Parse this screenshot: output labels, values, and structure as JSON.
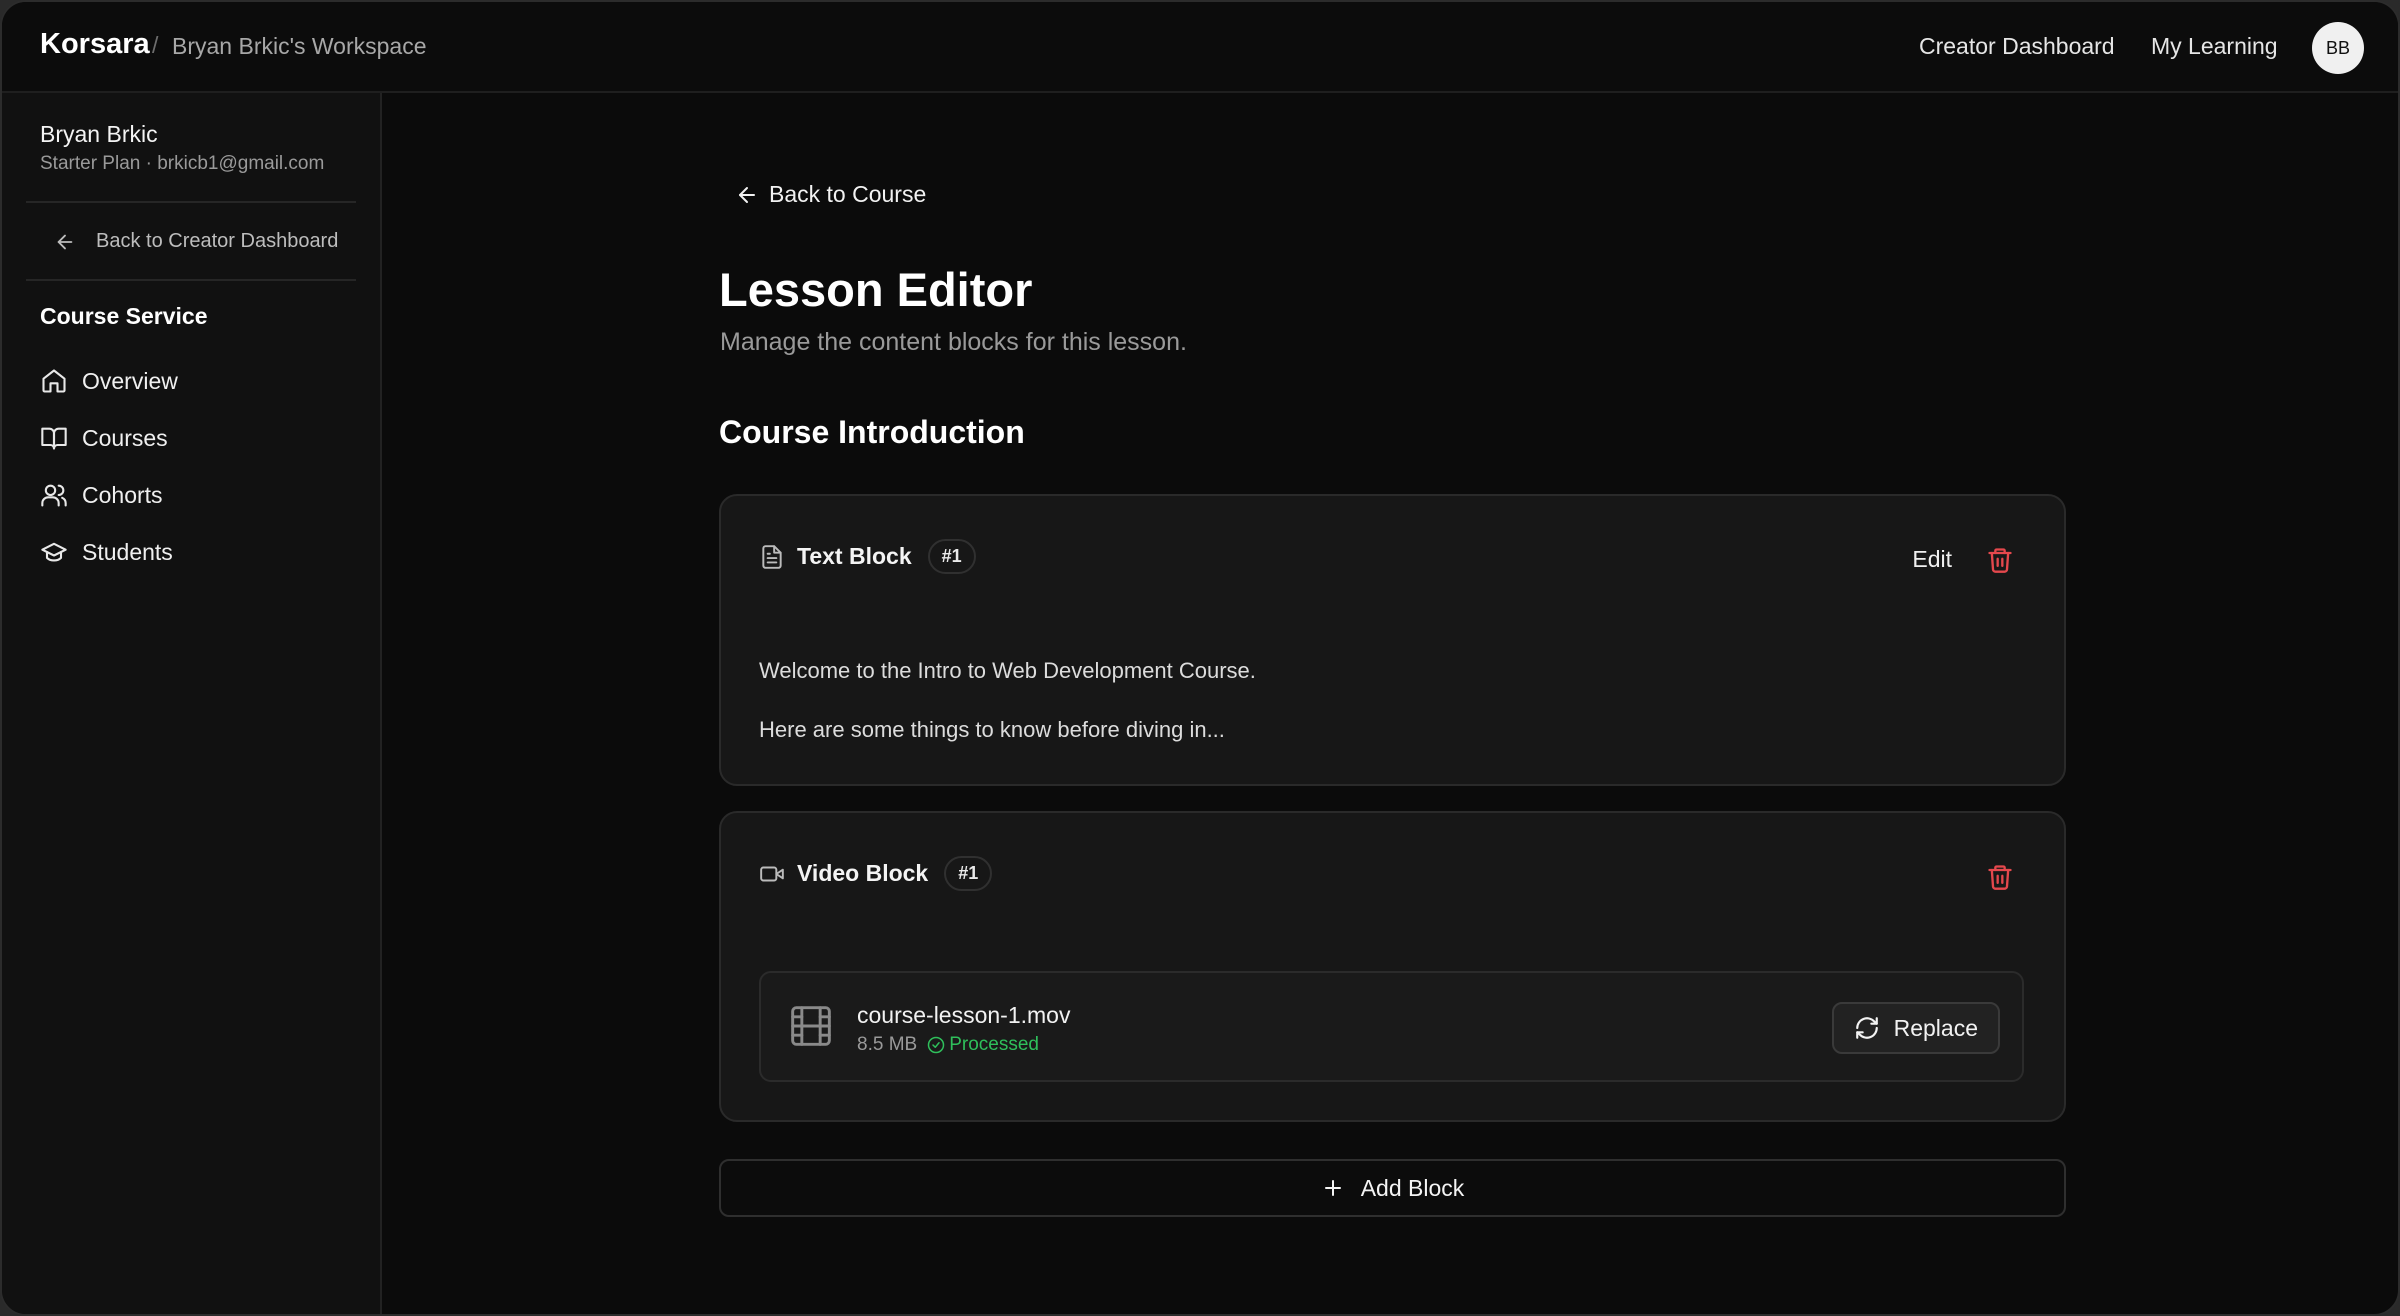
{
  "topbar": {
    "brand": "Korsara",
    "separator": "/",
    "workspace": "Bryan Brkic's Workspace",
    "nav_creator": "Creator Dashboard",
    "nav_learning": "My Learning",
    "avatar_initials": "BB"
  },
  "sidebar": {
    "user_name": "Bryan Brkic",
    "user_meta": "Starter Plan · brkicb1@gmail.com",
    "back_label": "Back to Creator Dashboard",
    "section_title": "Course Service",
    "items": [
      {
        "label": "Overview",
        "icon": "home-icon"
      },
      {
        "label": "Courses",
        "icon": "book-open-icon"
      },
      {
        "label": "Cohorts",
        "icon": "users-icon"
      },
      {
        "label": "Students",
        "icon": "graduation-cap-icon"
      }
    ]
  },
  "main": {
    "back_label": "Back to Course",
    "title": "Lesson Editor",
    "subtitle": "Manage the content blocks for this lesson.",
    "lesson_title": "Course Introduction",
    "text_block": {
      "title": "Text Block",
      "badge": "#1",
      "edit_label": "Edit",
      "lines": [
        "Welcome to the Intro to Web Development Course.",
        "Here are some things to know before diving in..."
      ]
    },
    "video_block": {
      "title": "Video Block",
      "badge": "#1",
      "file_name": "course-lesson-1.mov",
      "file_size": "8.5 MB",
      "status": "Processed",
      "replace_label": "Replace"
    },
    "add_block_label": "Add Block"
  },
  "colors": {
    "background": "#0b0b0b",
    "card": "#171717",
    "danger": "#e5484d",
    "success": "#2fbf5b"
  }
}
